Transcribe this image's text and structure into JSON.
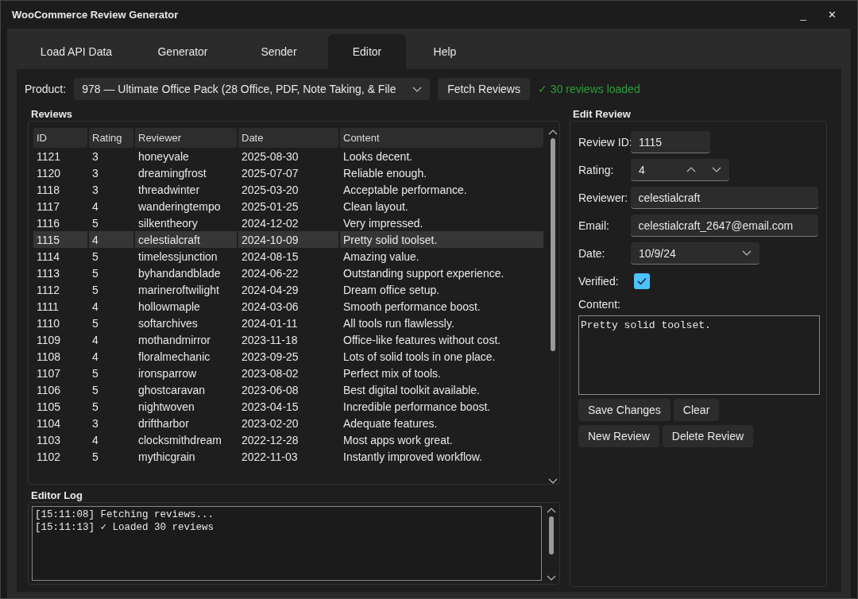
{
  "window": {
    "title": "WooCommerce Review Generator",
    "controls": [
      "_",
      "✕"
    ]
  },
  "tabs": [
    {
      "label": "Load API Data",
      "selected": false
    },
    {
      "label": "Generator",
      "selected": false
    },
    {
      "label": "Sender",
      "selected": false
    },
    {
      "label": "Editor",
      "selected": true
    },
    {
      "label": "Help",
      "selected": false
    }
  ],
  "product": {
    "label": "Product:",
    "value": "978 — Ultimate Office Pack (28 Office, PDF, Note Taking, & File",
    "button": "Fetch Reviews",
    "status": "✓ 30 reviews loaded"
  },
  "reviews": {
    "title": "Reviews",
    "columns": [
      "ID",
      "Rating",
      "Reviewer",
      "Date",
      "Content"
    ],
    "rows": [
      {
        "cells": [
          "1121",
          "3",
          "honeyvale",
          "2025-08-30",
          "Looks decent."
        ],
        "selected": false
      },
      {
        "cells": [
          "1120",
          "3",
          "dreamingfrost",
          "2025-07-07",
          "Reliable enough."
        ],
        "selected": false
      },
      {
        "cells": [
          "1118",
          "3",
          "threadwinter",
          "2025-03-20",
          "Acceptable performance."
        ],
        "selected": false
      },
      {
        "cells": [
          "1117",
          "4",
          "wanderingtempo",
          "2025-01-25",
          "Clean layout."
        ],
        "selected": false
      },
      {
        "cells": [
          "1116",
          "5",
          "silkentheory",
          "2024-12-02",
          "Very impressed."
        ],
        "selected": false
      },
      {
        "cells": [
          "1115",
          "4",
          "celestialcraft",
          "2024-10-09",
          "Pretty solid toolset."
        ],
        "selected": true
      },
      {
        "cells": [
          "1114",
          "5",
          "timelessjunction",
          "2024-08-15",
          "Amazing value."
        ],
        "selected": false
      },
      {
        "cells": [
          "1113",
          "5",
          "byhandandblade",
          "2024-06-22",
          "Outstanding support experience."
        ],
        "selected": false
      },
      {
        "cells": [
          "1112",
          "5",
          "marineroftwilight",
          "2024-04-29",
          "Dream office setup."
        ],
        "selected": false
      },
      {
        "cells": [
          "1111",
          "4",
          "hollowmaple",
          "2024-03-06",
          "Smooth performance boost."
        ],
        "selected": false
      },
      {
        "cells": [
          "1110",
          "5",
          "softarchives",
          "2024-01-11",
          "All tools run flawlessly."
        ],
        "selected": false
      },
      {
        "cells": [
          "1109",
          "4",
          "mothandmirror",
          "2023-11-18",
          "Office-like features without cost."
        ],
        "selected": false
      },
      {
        "cells": [
          "1108",
          "4",
          "floralmechanic",
          "2023-09-25",
          "Lots of solid tools in one place."
        ],
        "selected": false
      },
      {
        "cells": [
          "1107",
          "5",
          "ironsparrow",
          "2023-08-02",
          "Perfect mix of tools."
        ],
        "selected": false
      },
      {
        "cells": [
          "1106",
          "5",
          "ghostcaravan",
          "2023-06-08",
          "Best digital toolkit available."
        ],
        "selected": false
      },
      {
        "cells": [
          "1105",
          "5",
          "nightwoven",
          "2023-04-15",
          "Incredible performance boost."
        ],
        "selected": false
      },
      {
        "cells": [
          "1104",
          "3",
          "driftharbor",
          "2023-02-20",
          "Adequate features."
        ],
        "selected": false
      },
      {
        "cells": [
          "1103",
          "4",
          "clocksmithdream",
          "2022-12-28",
          "Most apps work great."
        ],
        "selected": false
      },
      {
        "cells": [
          "1102",
          "5",
          "mythicgrain",
          "2022-11-03",
          "Instantly improved workflow."
        ],
        "selected": false
      }
    ]
  },
  "log": {
    "title": "Editor Log",
    "lines": [
      "[15:11:08] Fetching reviews...",
      "[15:11:13] ✓ Loaded 30 reviews"
    ]
  },
  "edit": {
    "title": "Edit Review",
    "fields": [
      {
        "kind": "number",
        "label": "Review ID:",
        "value": "1115"
      },
      {
        "kind": "spin",
        "label": "Rating:",
        "value": "4"
      },
      {
        "kind": "text",
        "label": "Reviewer:",
        "value": "celestialcraft"
      },
      {
        "kind": "text",
        "label": "Email:",
        "value": "celestialcraft_2647@email.com"
      },
      {
        "kind": "date",
        "label": "Date:",
        "value": "10/9/24"
      },
      {
        "kind": "checkbox",
        "label": "Verified:",
        "checked": true
      }
    ],
    "content_label": "Content:",
    "content": "Pretty solid toolset.",
    "buttons": [
      [
        "Save Changes",
        "Clear"
      ],
      [
        "New Review",
        "Delete Review"
      ]
    ]
  }
}
